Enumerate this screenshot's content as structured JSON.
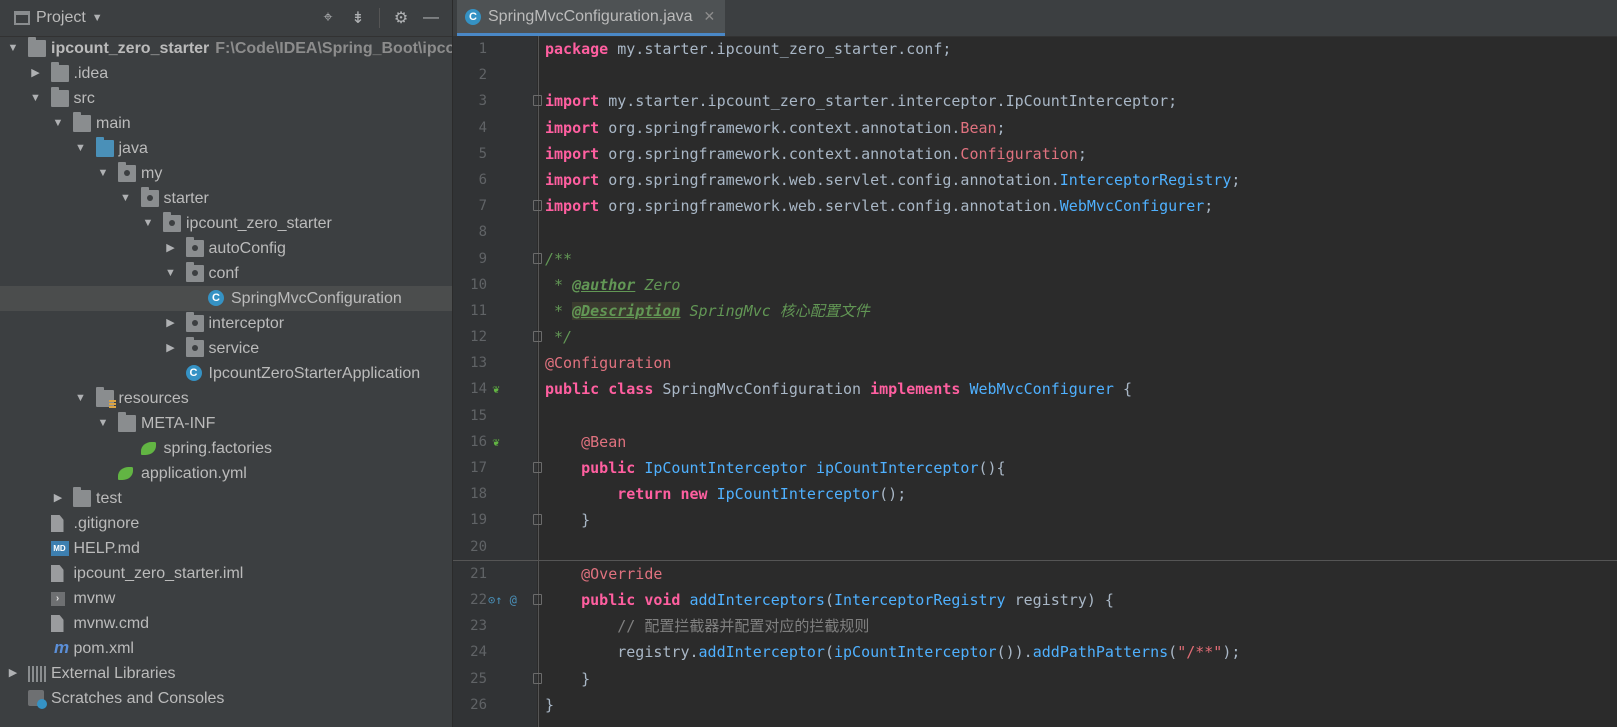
{
  "project_panel": {
    "title": "Project",
    "tree": [
      {
        "label": "ipcount_zero_starter",
        "path": "F:\\Code\\IDEA\\Spring_Boot\\ipcou",
        "depth": 0,
        "arrow": "down",
        "icon": "module-folder-icon",
        "bold": true
      },
      {
        "label": ".idea",
        "depth": 1,
        "arrow": "right",
        "icon": "folder-icon"
      },
      {
        "label": "src",
        "depth": 1,
        "arrow": "down",
        "icon": "folder-icon"
      },
      {
        "label": "main",
        "depth": 2,
        "arrow": "down",
        "icon": "folder-icon"
      },
      {
        "label": "java",
        "depth": 3,
        "arrow": "down",
        "icon": "source-folder-icon"
      },
      {
        "label": "my",
        "depth": 4,
        "arrow": "down",
        "icon": "package-icon"
      },
      {
        "label": "starter",
        "depth": 5,
        "arrow": "down",
        "icon": "package-icon"
      },
      {
        "label": "ipcount_zero_starter",
        "depth": 6,
        "arrow": "down",
        "icon": "package-icon"
      },
      {
        "label": "autoConfig",
        "depth": 7,
        "arrow": "right",
        "icon": "package-icon"
      },
      {
        "label": "conf",
        "depth": 7,
        "arrow": "down",
        "icon": "package-icon"
      },
      {
        "label": "SpringMvcConfiguration",
        "depth": 8,
        "arrow": "",
        "icon": "class-icon",
        "selected": true
      },
      {
        "label": "interceptor",
        "depth": 7,
        "arrow": "right",
        "icon": "package-icon"
      },
      {
        "label": "service",
        "depth": 7,
        "arrow": "right",
        "icon": "package-icon"
      },
      {
        "label": "IpcountZeroStarterApplication",
        "depth": 7,
        "arrow": "",
        "icon": "spring-boot-class-icon"
      },
      {
        "label": "resources",
        "depth": 3,
        "arrow": "down",
        "icon": "resources-folder-icon"
      },
      {
        "label": "META-INF",
        "depth": 4,
        "arrow": "down",
        "icon": "folder-icon"
      },
      {
        "label": "spring.factories",
        "depth": 5,
        "arrow": "",
        "icon": "spring-leaf-icon"
      },
      {
        "label": "application.yml",
        "depth": 4,
        "arrow": "",
        "icon": "spring-config-icon"
      },
      {
        "label": "test",
        "depth": 2,
        "arrow": "right",
        "icon": "folder-icon"
      },
      {
        "label": ".gitignore",
        "depth": 1,
        "arrow": "",
        "icon": "file-icon"
      },
      {
        "label": "HELP.md",
        "depth": 1,
        "arrow": "",
        "icon": "markdown-icon"
      },
      {
        "label": "ipcount_zero_starter.iml",
        "depth": 1,
        "arrow": "",
        "icon": "file-icon"
      },
      {
        "label": "mvnw",
        "depth": 1,
        "arrow": "",
        "icon": "terminal-icon"
      },
      {
        "label": "mvnw.cmd",
        "depth": 1,
        "arrow": "",
        "icon": "file-icon"
      },
      {
        "label": "pom.xml",
        "depth": 1,
        "arrow": "",
        "icon": "maven-icon"
      },
      {
        "label": "External Libraries",
        "depth": 0,
        "arrow": "right",
        "icon": "libraries-icon"
      },
      {
        "label": "Scratches and Consoles",
        "depth": 0,
        "arrow": "",
        "icon": "scratches-icon"
      }
    ]
  },
  "editor": {
    "tab_label": "SpringMvcConfiguration.java",
    "lines": [
      {
        "n": "1",
        "t": [
          [
            "kw2",
            "package"
          ],
          [
            "pk",
            " my.starter.ipcount_zero_starter.conf;"
          ]
        ]
      },
      {
        "n": "2",
        "t": []
      },
      {
        "n": "3",
        "fold": true,
        "t": [
          [
            "kw2",
            "import"
          ],
          [
            "pk",
            " my.starter.ipcount_zero_starter.interceptor.IpCountInterceptor;"
          ]
        ]
      },
      {
        "n": "4",
        "t": [
          [
            "kw2",
            "import"
          ],
          [
            "pk",
            " org.springframework.context.annotation."
          ],
          [
            "ann",
            "Bean"
          ],
          [
            "pk",
            ";"
          ]
        ]
      },
      {
        "n": "5",
        "t": [
          [
            "kw2",
            "import"
          ],
          [
            "pk",
            " org.springframework.context.annotation."
          ],
          [
            "ann",
            "Configuration"
          ],
          [
            "pk",
            ";"
          ]
        ]
      },
      {
        "n": "6",
        "t": [
          [
            "kw2",
            "import"
          ],
          [
            "pk",
            " org.springframework.web.servlet.config.annotation."
          ],
          [
            "ty2",
            "InterceptorRegistry"
          ],
          [
            "pk",
            ";"
          ]
        ]
      },
      {
        "n": "7",
        "fold": true,
        "t": [
          [
            "kw2",
            "import"
          ],
          [
            "pk",
            " org.springframework.web.servlet.config.annotation."
          ],
          [
            "ty2",
            "WebMvcConfigurer"
          ],
          [
            "pk",
            ";"
          ]
        ]
      },
      {
        "n": "8",
        "t": []
      },
      {
        "n": "9",
        "fold": true,
        "t": [
          [
            "cm",
            "/**"
          ]
        ]
      },
      {
        "n": "10",
        "t": [
          [
            "cm",
            " * "
          ],
          [
            "tag",
            "@author"
          ],
          [
            "cm",
            " Zero"
          ]
        ]
      },
      {
        "n": "11",
        "t": [
          [
            "cm",
            " * "
          ],
          [
            "tag tagbg",
            "@Description"
          ],
          [
            "cm",
            " SpringMvc 核心配置文件"
          ]
        ]
      },
      {
        "n": "12",
        "fold": true,
        "t": [
          [
            "cm",
            " */"
          ]
        ]
      },
      {
        "n": "13",
        "t": [
          [
            "ann",
            "@Configuration"
          ]
        ]
      },
      {
        "n": "14",
        "gutter": "spring-bean-icon",
        "t": [
          [
            "kw2",
            "public"
          ],
          [
            "pk",
            " "
          ],
          [
            "kw2",
            "class"
          ],
          [
            "pk",
            " SpringMvcConfiguration "
          ],
          [
            "kw2",
            "implements"
          ],
          [
            "pk",
            " "
          ],
          [
            "ty2",
            "WebMvcConfigurer"
          ],
          [
            "pk",
            " {"
          ]
        ]
      },
      {
        "n": "15",
        "t": []
      },
      {
        "n": "16",
        "gutter": "spring-bean-icon",
        "t": [
          [
            "pk",
            "    "
          ],
          [
            "ann",
            "@Bean"
          ]
        ]
      },
      {
        "n": "17",
        "fold": true,
        "t": [
          [
            "pk",
            "    "
          ],
          [
            "kw2",
            "public"
          ],
          [
            "pk",
            " "
          ],
          [
            "ty2",
            "IpCountInterceptor"
          ],
          [
            "pk",
            " "
          ],
          [
            "fn",
            "ipCountInterceptor"
          ],
          [
            "pk",
            "(){"
          ]
        ]
      },
      {
        "n": "18",
        "t": [
          [
            "pk",
            "        "
          ],
          [
            "kw2",
            "return"
          ],
          [
            "pk",
            " "
          ],
          [
            "kw2",
            "new"
          ],
          [
            "pk",
            " "
          ],
          [
            "ty2",
            "IpCountInterceptor"
          ],
          [
            "pk",
            "();"
          ]
        ]
      },
      {
        "n": "19",
        "fold": true,
        "t": [
          [
            "pk",
            "    }"
          ]
        ]
      },
      {
        "n": "20",
        "t": []
      },
      {
        "n": "21",
        "sep": true,
        "t": [
          [
            "pk",
            "    "
          ],
          [
            "ann",
            "@Override"
          ]
        ]
      },
      {
        "n": "22",
        "gutter": "override-icon",
        "fold": true,
        "t": [
          [
            "pk",
            "    "
          ],
          [
            "kw2",
            "public"
          ],
          [
            "pk",
            " "
          ],
          [
            "kw2",
            "void"
          ],
          [
            "pk",
            " "
          ],
          [
            "fn",
            "addInterceptors"
          ],
          [
            "pk",
            "("
          ],
          [
            "ty2",
            "InterceptorRegistry"
          ],
          [
            "pk",
            " registry) {"
          ]
        ]
      },
      {
        "n": "23",
        "t": [
          [
            "pk",
            "        "
          ],
          [
            "lc",
            "// 配置拦截器并配置对应的拦截规则"
          ]
        ]
      },
      {
        "n": "24",
        "t": [
          [
            "pk",
            "        registry."
          ],
          [
            "fn",
            "addInterceptor"
          ],
          [
            "pk",
            "("
          ],
          [
            "fn",
            "ipCountInterceptor"
          ],
          [
            "pk",
            "())."
          ],
          [
            "fn",
            "addPathPatterns"
          ],
          [
            "pk",
            "("
          ],
          [
            "str",
            "\"/**\""
          ],
          [
            "pk",
            ");"
          ]
        ]
      },
      {
        "n": "25",
        "fold": true,
        "t": [
          [
            "pk",
            "    }"
          ]
        ]
      },
      {
        "n": "26",
        "t": [
          [
            "pk",
            "}"
          ]
        ]
      }
    ]
  }
}
